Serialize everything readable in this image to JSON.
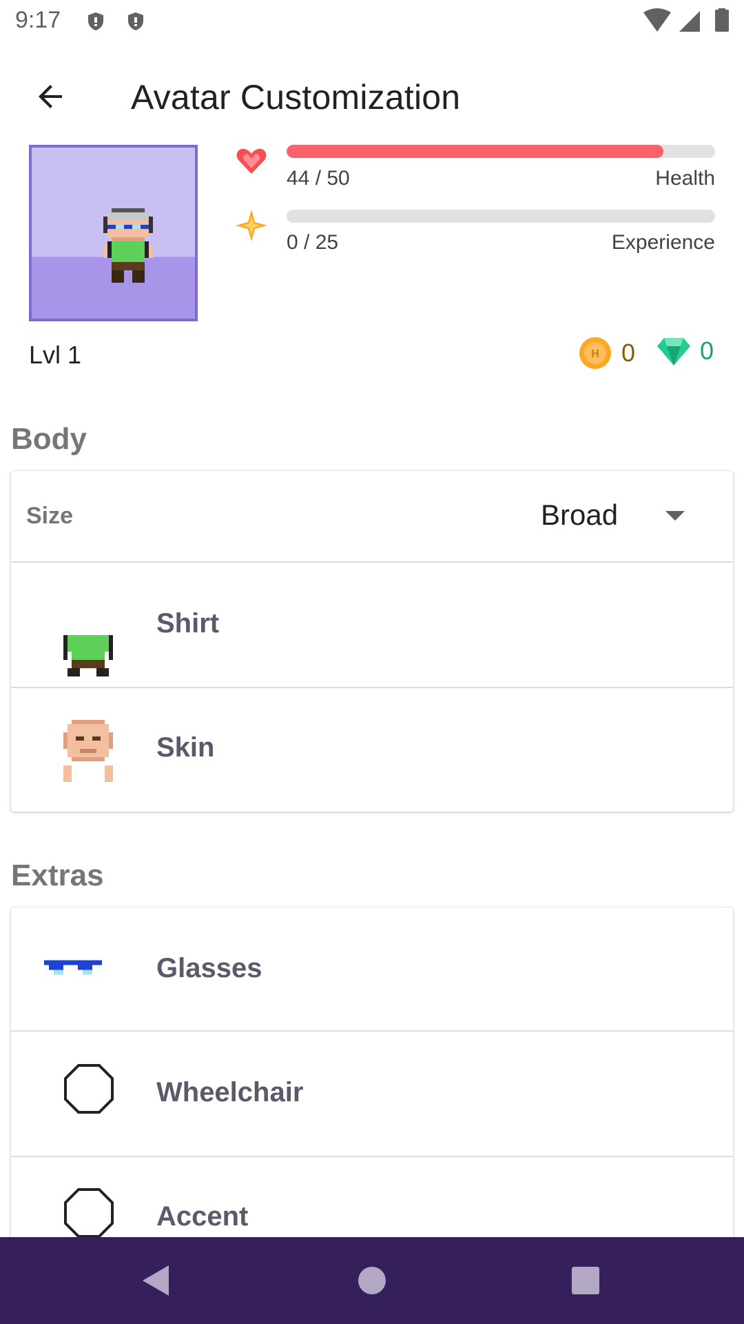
{
  "status_bar": {
    "time": "9:17",
    "icons": [
      "shield-icon",
      "shield-icon",
      "wifi-icon",
      "cellular-icon",
      "battery-icon"
    ]
  },
  "app_bar": {
    "title": "Avatar Customization",
    "back_icon": "back-arrow-icon"
  },
  "stats": {
    "health": {
      "value": "44 / 50",
      "label": "Health",
      "fraction": 0.88,
      "color": "#f8636b",
      "icon": "heart-icon"
    },
    "experience": {
      "value": "0 / 25",
      "label": "Experience",
      "fraction": 0.0,
      "color": "#ffa623",
      "icon": "star-icon"
    },
    "level": "Lvl 1",
    "gold": {
      "value": "0",
      "icon": "gold-coin-icon",
      "color": "#8a5d00"
    },
    "gems": {
      "value": "0",
      "icon": "gem-icon",
      "color": "#1ca372"
    }
  },
  "body_section": {
    "title": "Body",
    "size": {
      "label": "Size",
      "value": "Broad"
    },
    "items": [
      {
        "label": "Shirt",
        "icon": "shirt-icon"
      },
      {
        "label": "Skin",
        "icon": "skin-icon"
      }
    ]
  },
  "extras_section": {
    "title": "Extras",
    "items": [
      {
        "label": "Glasses",
        "icon": "glasses-icon"
      },
      {
        "label": "Wheelchair",
        "icon": "wheelchair-icon"
      },
      {
        "label": "Accent",
        "icon": "accent-icon"
      }
    ]
  },
  "nav": {
    "icons": [
      "nav-back-icon",
      "nav-home-icon",
      "nav-recents-icon"
    ]
  },
  "colors": {
    "nav_background": "#36205c",
    "avatar_border": "#7d6ad6"
  }
}
